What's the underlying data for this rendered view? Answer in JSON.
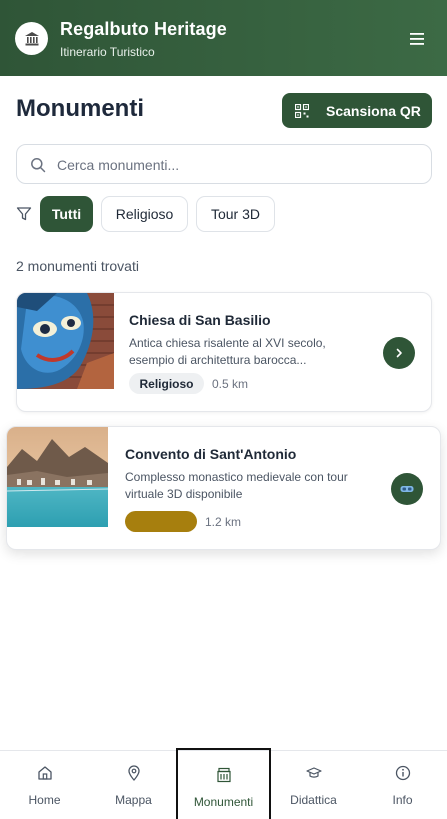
{
  "header": {
    "title": "Regalbuto Heritage",
    "subtitle": "Itinerario Turistico",
    "logo_icon": "museum-icon",
    "menu_icon": "hamburger-menu-icon"
  },
  "page": {
    "title": "Monumenti",
    "qr_button_label": "Scansiona QR"
  },
  "search": {
    "placeholder": "Cerca monumenti...",
    "value": ""
  },
  "filters": {
    "items": [
      {
        "label": "Tutti",
        "active": true
      },
      {
        "label": "Religioso",
        "active": false
      },
      {
        "label": "Tour 3D",
        "active": false
      }
    ]
  },
  "results": {
    "count_text": "2 monumenti trovati"
  },
  "monuments": [
    {
      "title": "Chiesa di San Basilio",
      "description": "Antica chiesa risalente al XVI secolo, esempio di architettura barocca...",
      "category": "Religioso",
      "distance": "0.5 km"
    },
    {
      "title": "Convento di Sant'Antonio",
      "description": "Complesso monastico medievale con tour virtuale 3D disponibile",
      "category": "",
      "distance": "1.2 km"
    }
  ],
  "bottom_nav": {
    "items": [
      {
        "label": "Home",
        "icon": "home-icon",
        "active": false
      },
      {
        "label": "Mappa",
        "icon": "map-pin-icon",
        "active": false
      },
      {
        "label": "Monumenti",
        "icon": "landmark-icon",
        "active": true
      },
      {
        "label": "Didattica",
        "icon": "graduation-cap-icon",
        "active": false
      },
      {
        "label": "Info",
        "icon": "info-icon",
        "active": false
      }
    ]
  },
  "colors": {
    "primary": "#2f5537",
    "accent_badge": "#a77f0e"
  }
}
